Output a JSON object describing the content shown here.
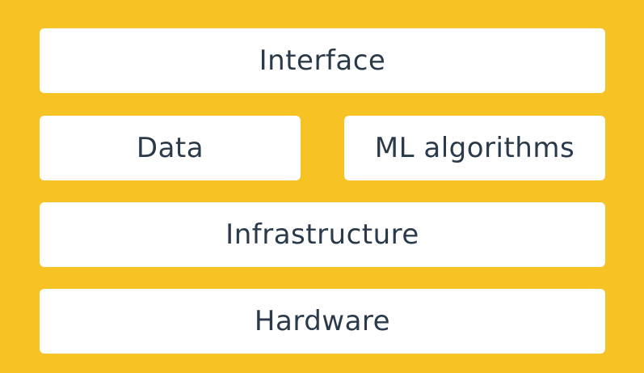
{
  "diagram": {
    "background_color": "#F6C224",
    "box_color": "#FFFFFF",
    "text_color": "#2B3A4A",
    "layers": {
      "interface": "Interface",
      "data": "Data",
      "ml_algorithms": "ML algorithms",
      "infrastructure": "Infrastructure",
      "hardware": "Hardware"
    }
  }
}
